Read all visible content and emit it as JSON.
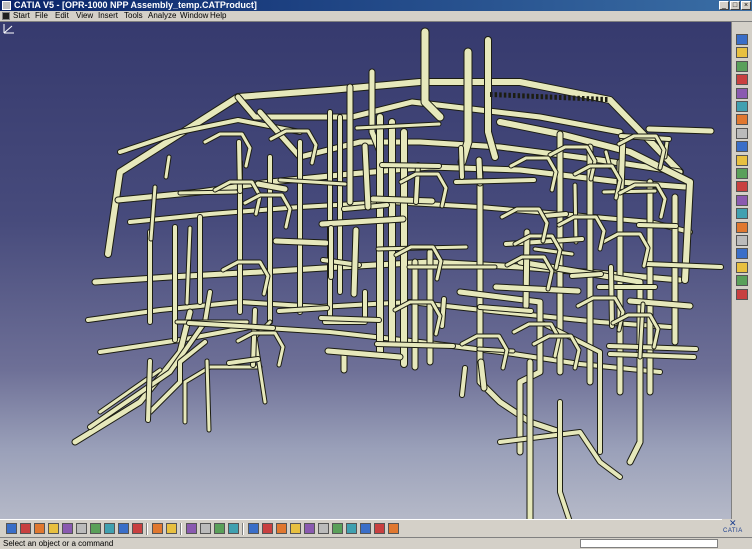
{
  "window": {
    "title": "CATIA V5 - [OPR-1000 NPP Assembly_temp.CATProduct]"
  },
  "menu": {
    "items": [
      "Start",
      "File",
      "Edit",
      "View",
      "Insert",
      "Tools",
      "Analyze",
      "Window",
      "Help"
    ]
  },
  "viewport": {
    "background_top": "#363a6e",
    "background_bottom": "#b5b9c8",
    "pipe_color": "#e6e8bb",
    "pipe_outline": "#1c1d12",
    "logo_text": "CATIA"
  },
  "status": {
    "message": "Select an object or a command",
    "command_placeholder": ""
  },
  "right_toolbar": {
    "icons": [
      "sketcher-icon",
      "part-design-icon",
      "assembly-icon",
      "new-component-icon",
      "new-product-icon",
      "new-part-icon",
      "existing-component-icon",
      "replace-component-icon",
      "graph-tree-icon",
      "generate-numbering-icon",
      "selective-load-icon",
      "manage-representations-icon",
      "fast-multi-instantiation-icon",
      "reorder-icon",
      "manipulation-icon",
      "snap-icon",
      "explode-icon",
      "stop-manipulate-icon",
      "sun-icon",
      "clash-icon"
    ]
  },
  "bottom_toolbar": {
    "icons": [
      "new-icon",
      "open-icon",
      "save-icon",
      "quick-print-icon",
      "cut-icon",
      "copy-icon",
      "paste-icon",
      "undo-icon",
      "redo-icon",
      "whats-this-icon",
      "catalog-icon",
      "formula-icon",
      "knowledge-icon",
      "measure-icon",
      "mass-icon",
      "apply-material-icon",
      "fly-mode-icon",
      "fit-all-icon",
      "pan-icon",
      "rotate-icon",
      "zoom-in-icon",
      "zoom-out-icon",
      "normal-view-icon",
      "quick-view-icon",
      "view-mode-icon",
      "hide-show-icon",
      "swap-visible-space-icon"
    ]
  }
}
